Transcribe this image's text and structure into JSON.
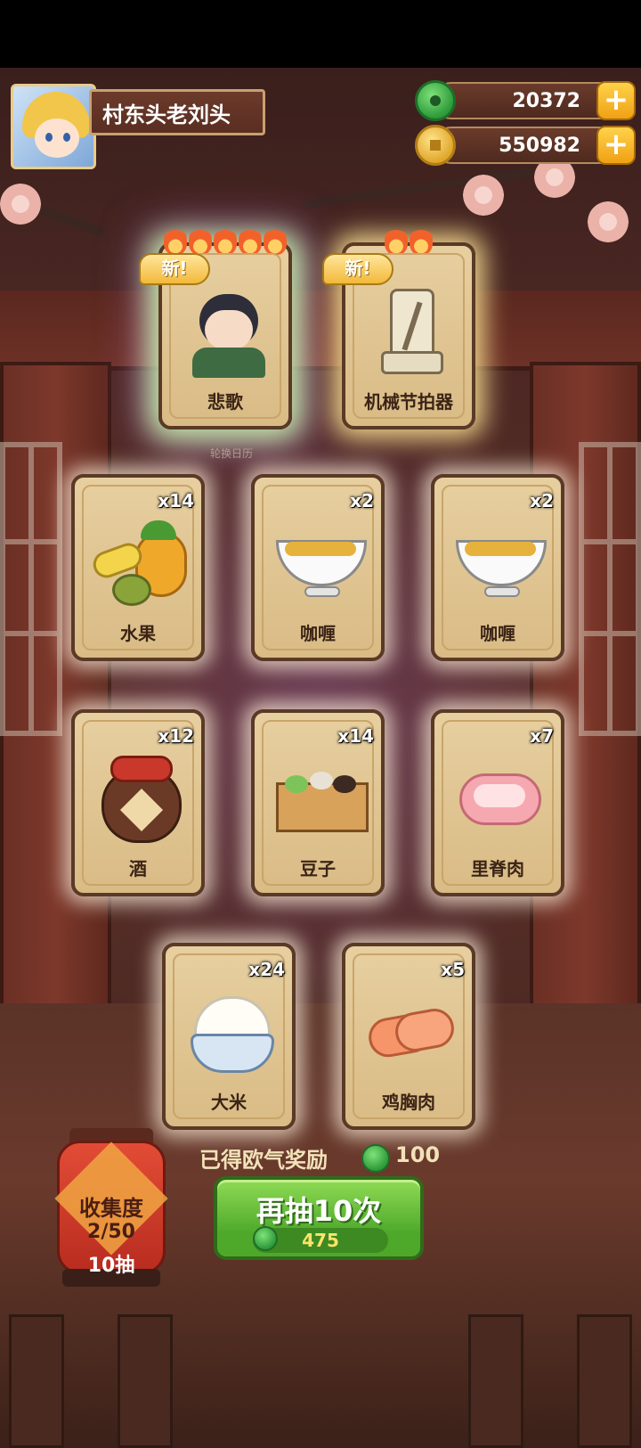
{
  "player": {
    "name": "村东头老刘头"
  },
  "currencies": {
    "jade": "20372",
    "coins": "550982",
    "plus_label": "+"
  },
  "featured_cards": [
    {
      "label": "悲歌",
      "badge": "新!",
      "rarity": "legendary"
    },
    {
      "label": "机械节拍器",
      "badge": "新!",
      "rarity": "rare"
    }
  ],
  "background_text": "轮换日历",
  "cards": [
    {
      "label": "水果",
      "count": "x14"
    },
    {
      "label": "咖喱",
      "count": "x2"
    },
    {
      "label": "咖喱",
      "count": "x2"
    },
    {
      "label": "酒",
      "count": "x12"
    },
    {
      "label": "豆子",
      "count": "x14"
    },
    {
      "label": "里脊肉",
      "count": "x7"
    },
    {
      "label": "大米",
      "count": "x24"
    },
    {
      "label": "鸡胸肉",
      "count": "x5"
    }
  ],
  "reward": {
    "label": "已得欧气奖励",
    "value": "100"
  },
  "draw_button": {
    "label": "再抽10次",
    "cost": "475"
  },
  "collection": {
    "title": "收集度",
    "progress": "2/50",
    "subtitle": "10抽"
  },
  "colors": {
    "accent_green": "#4ea82a",
    "jade_green": "#2e9a3a",
    "gold": "#f0a114",
    "card_bg": "#e7cfa0"
  }
}
